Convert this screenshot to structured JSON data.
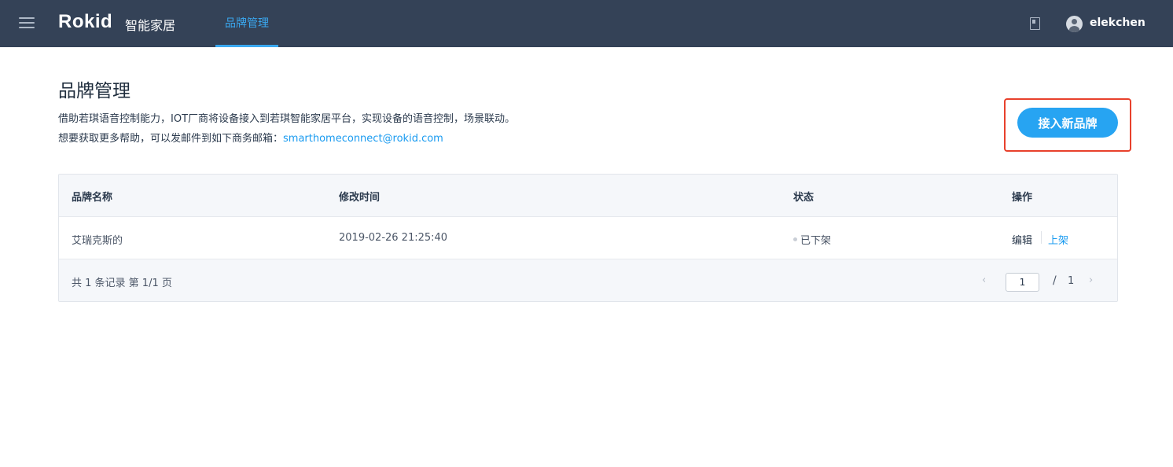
{
  "topbar": {
    "logo": "Rokid",
    "product": "智能家居",
    "active_tab": "品牌管理",
    "username": "elekchen"
  },
  "header": {
    "title": "品牌管理",
    "desc_line1": "借助若琪语音控制能力，IOT厂商将设备接入到若琪智能家居平台，实现设备的语音控制，场景联动。",
    "desc_line2_prefix": "想要获取更多帮助，可以发邮件到如下商务邮箱：",
    "email": "smarthomeconnect@rokid.com",
    "add_button": "接入新品牌"
  },
  "table": {
    "columns": [
      "品牌名称",
      "修改时间",
      "状态",
      "操作"
    ],
    "rows": [
      {
        "brand": "艾瑞克斯的",
        "modified": "2019-02-26 21:25:40",
        "status": "已下架",
        "actions": [
          "编辑",
          "上架"
        ]
      }
    ],
    "summary": "共 1 条记录 第 1/1 页",
    "pagination": {
      "current": "1",
      "separator": "/",
      "total": "1",
      "prev": "‹",
      "next": "›"
    }
  },
  "colors": {
    "topbar_bg": "#344257",
    "accent": "#27a4f2",
    "highlight_border": "#e8412c"
  },
  "icons": [
    "menu-icon",
    "document-icon",
    "user-avatar-icon",
    "chevron-left-icon",
    "chevron-right-icon",
    "status-dot-icon"
  ]
}
